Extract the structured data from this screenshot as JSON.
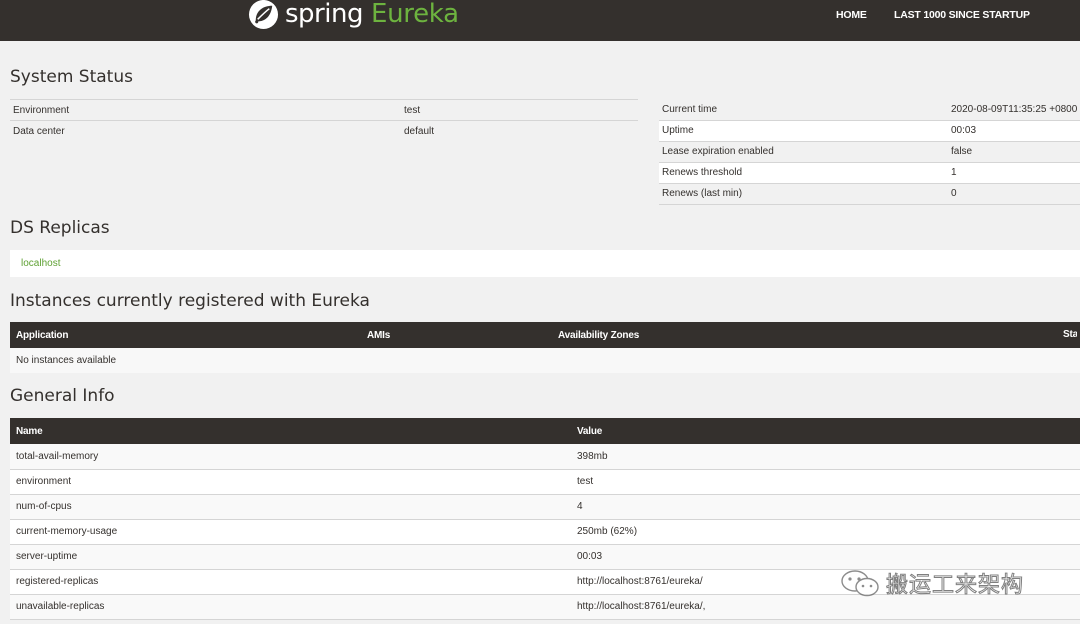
{
  "header": {
    "brand_spring": "spring",
    "brand_eureka": "Eureka",
    "nav": [
      {
        "label": "HOME"
      },
      {
        "label": "LAST 1000 SINCE STARTUP"
      }
    ]
  },
  "system_status": {
    "title": "System Status",
    "left": [
      {
        "key": "Environment",
        "value": "test"
      },
      {
        "key": "Data center",
        "value": "default"
      }
    ],
    "right": [
      {
        "key": "Current time",
        "value": "2020-08-09T11:35:25 +0800"
      },
      {
        "key": "Uptime",
        "value": "00:03"
      },
      {
        "key": "Lease expiration enabled",
        "value": "false"
      },
      {
        "key": "Renews threshold",
        "value": "1"
      },
      {
        "key": "Renews (last min)",
        "value": "0"
      }
    ]
  },
  "replicas": {
    "title": "DS Replicas",
    "items": [
      "localhost"
    ]
  },
  "instances": {
    "title": "Instances currently registered with Eureka",
    "columns": [
      "Application",
      "AMIs",
      "Availability Zones",
      "Status"
    ],
    "empty_text": "No instances available"
  },
  "general_info": {
    "title": "General Info",
    "columns": [
      "Name",
      "Value"
    ],
    "rows": [
      {
        "name": "total-avail-memory",
        "value": "398mb"
      },
      {
        "name": "environment",
        "value": "test"
      },
      {
        "name": "num-of-cpus",
        "value": "4"
      },
      {
        "name": "current-memory-usage",
        "value": "250mb (62%)"
      },
      {
        "name": "server-uptime",
        "value": "00:03"
      },
      {
        "name": "registered-replicas",
        "value": "http://localhost:8761/eureka/"
      },
      {
        "name": "unavailable-replicas",
        "value": "http://localhost:8761/eureka/,"
      }
    ]
  },
  "watermark": {
    "text": "搬运工来架构",
    "icon": "wechat-icon"
  },
  "colors": {
    "header_bg": "#34302d",
    "brand_green": "#6db33f",
    "page_bg": "#f1f1f1"
  }
}
